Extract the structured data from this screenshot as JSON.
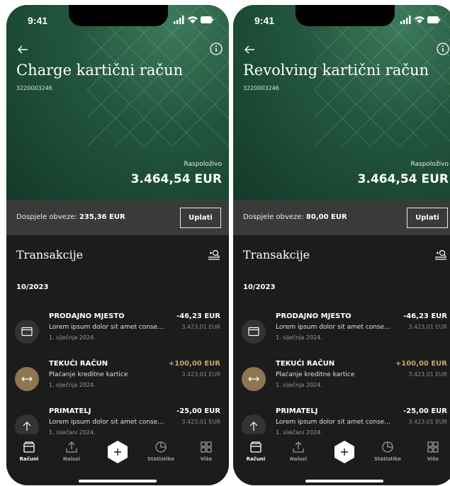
{
  "screens": [
    {
      "status": {
        "time": "9:41"
      },
      "title": "Charge kartični račun",
      "account_number": "3220003246",
      "available_label": "Raspoloživo",
      "available_value": "3.464,54 EUR",
      "due_label": "Dospjele obveze:",
      "due_value": "235,36 EUR",
      "pay_label": "Uplati",
      "transactions_title": "Transakcije",
      "month": "10/2023",
      "transactions": [
        {
          "icon": "card-icon",
          "name": "PRODAJNO MJESTO",
          "description": "Lorem ipsum dolor sit amet consectetur",
          "date": "1. siječnja 2024.",
          "amount": "-46,23 EUR",
          "balance": "3.423,01 EUR"
        },
        {
          "icon": "transfer-icon",
          "name": "TEKUĆI RAČUN",
          "description": "Plaćanje kreditne kartice",
          "date": "1. siječnja 2024.",
          "amount": "+100,00 EUR",
          "balance": "3.423,01 EUR"
        },
        {
          "icon": "arrow-up-icon",
          "name": "PRIMATELJ",
          "description": "Lorem ipsum dolor sit amet consectetur",
          "date": "1. siječanj 2024.",
          "amount": "-25,00 EUR",
          "balance": "3.423,01 EUR"
        }
      ],
      "tabs": {
        "accounts": "Računi",
        "orders": "Nalozi",
        "statistics": "Statistike",
        "more": "Više"
      }
    },
    {
      "status": {
        "time": "9:41"
      },
      "title": "Revolving kartični račun",
      "account_number": "3220003246",
      "available_label": "Raspoloživo",
      "available_value": "3.464,54 EUR",
      "due_label": "Dospjele obveze:",
      "due_value": "80,00 EUR",
      "pay_label": "Uplati",
      "transactions_title": "Transakcije",
      "month": "10/2023",
      "transactions": [
        {
          "icon": "card-icon",
          "name": "PRODAJNO MJESTO",
          "description": "Lorem ipsum dolor sit amet consectetur",
          "date": "1. siječnja 2024.",
          "amount": "-46,23 EUR",
          "balance": "3.423,01 EUR"
        },
        {
          "icon": "transfer-icon",
          "name": "TEKUĆI RAČUN",
          "description": "Plaćanje kreditne kartice",
          "date": "1. siječnja 2024.",
          "amount": "+100,00 EUR",
          "balance": "3.423,01 EUR"
        },
        {
          "icon": "arrow-up-icon",
          "name": "PRIMATELJ",
          "description": "Lorem ipsum dolor sit amet consectetur",
          "date": "1. siječanj 2024.",
          "amount": "-25,00 EUR",
          "balance": "3.423,01 EUR"
        }
      ],
      "tabs": {
        "accounts": "Računi",
        "orders": "Nalozi",
        "statistics": "Statistike",
        "more": "Više"
      }
    }
  ],
  "colors": {
    "hero_green": "#24573f",
    "background": "#1c1c1c",
    "due_bar": "#3a3a3a",
    "positive_amount": "#c9a46a",
    "transfer_badge": "#8e7650"
  }
}
